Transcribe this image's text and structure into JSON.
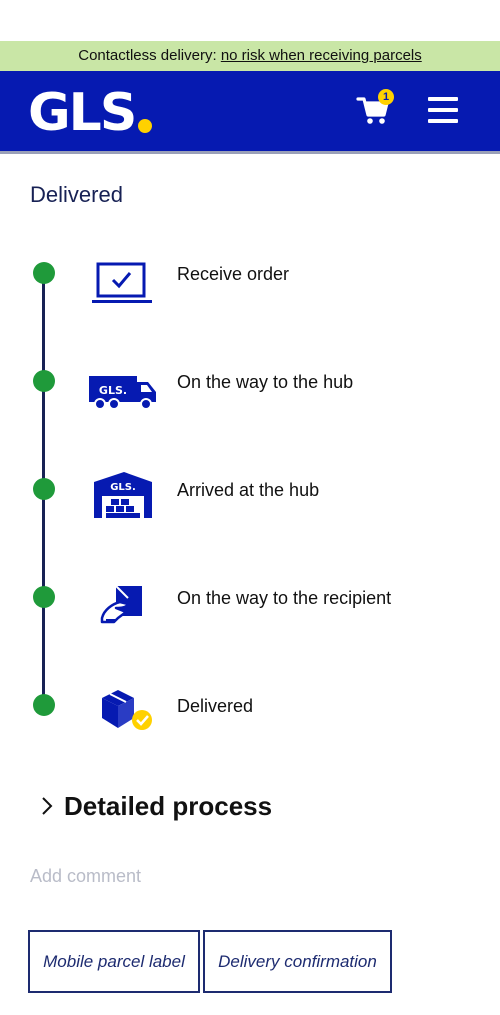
{
  "banner": {
    "prefix": "Contactless delivery: ",
    "link": "no risk when receiving parcels"
  },
  "header": {
    "logo_text": "GLS",
    "cart_count": "1",
    "cart_icon": "shopping-cart-icon",
    "menu_icon": "hamburger-menu-icon"
  },
  "status": {
    "title": "Delivered"
  },
  "steps": [
    {
      "label": "Receive order",
      "icon": "laptop-check-icon"
    },
    {
      "label": "On the way to the hub",
      "icon": "gls-truck-icon",
      "icon_text": "GLS."
    },
    {
      "label": "Arrived at the hub",
      "icon": "gls-warehouse-icon",
      "icon_text": "GLS."
    },
    {
      "label": "On the way to the recipient",
      "icon": "hand-parcel-icon"
    },
    {
      "label": "Delivered",
      "icon": "parcel-check-icon"
    }
  ],
  "detailed_process": {
    "label": "Detailed process"
  },
  "comment": {
    "placeholder": "Add comment"
  },
  "buttons": {
    "mobile_label": "Mobile parcel label",
    "confirmation": "Delivery confirmation"
  },
  "colors": {
    "brand_blue": "#061ab1",
    "brand_yellow": "#ffd100",
    "banner_green": "#c9e6a6",
    "step_green": "#1f9a3a",
    "navy": "#172154"
  }
}
